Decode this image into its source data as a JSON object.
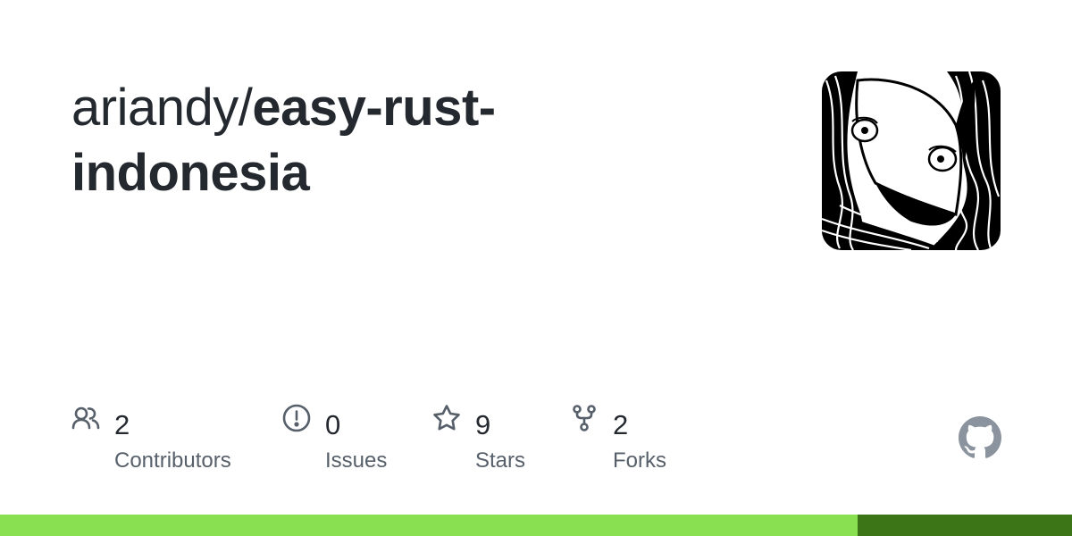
{
  "repo": {
    "owner": "ariandy/",
    "name": "easy-rust-indonesia"
  },
  "stats": {
    "contributors": {
      "value": "2",
      "label": "Contributors",
      "icon": "people-icon"
    },
    "issues": {
      "value": "0",
      "label": "Issues",
      "icon": "issue-opened-icon"
    },
    "stars": {
      "value": "9",
      "label": "Stars",
      "icon": "star-icon"
    },
    "forks": {
      "value": "2",
      "label": "Forks",
      "icon": "repo-forked-icon"
    }
  },
  "language_bar": {
    "segments": [
      {
        "color": "#89e051",
        "fraction": 0.8
      },
      {
        "color": "#3c7518",
        "fraction": 0.2
      }
    ]
  },
  "colors": {
    "text": "#24292f",
    "muted": "#57606a",
    "icon": "#57606a",
    "github_mark": "#8b949e"
  }
}
